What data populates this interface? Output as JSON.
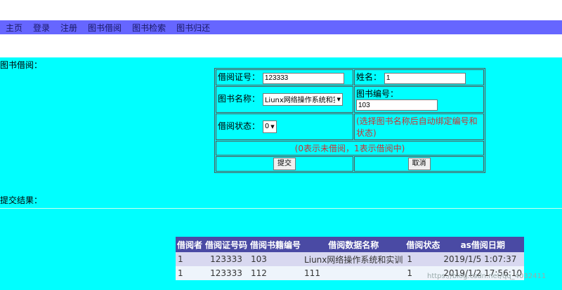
{
  "nav": {
    "items": [
      "主页",
      "登录",
      "注册",
      "图书借阅",
      "图书检索",
      "图书归还"
    ]
  },
  "borrow_section": {
    "title": "图书借阅："
  },
  "form": {
    "card_label": "借阅证号：",
    "card_value": "123333",
    "name_label": "姓名：",
    "name_value": "1",
    "book_name_label": "图书名称：",
    "book_name_selected": "Liunx网络操作系统和实",
    "book_id_label": "图书编号：",
    "book_id_value": "103",
    "status_label": "借阅状态：",
    "status_selected": "0",
    "auto_hint": "(选择图书名称后自动绑定编号和状态)",
    "status_hint": "(0表示未借阅，1表示借阅中)",
    "submit_label": "提交",
    "cancel_label": "取消"
  },
  "result_section": {
    "title": "提交结果："
  },
  "result_table": {
    "headers": [
      "借阅者",
      "借阅证号码",
      "借阅书籍编号",
      "借阅数据名称",
      "借阅状态",
      "as借阅日期"
    ],
    "rows": [
      [
        "1",
        "123333",
        "103",
        "Liunx网络操作系统和实训",
        "1",
        "2019/1/5 1:07:37"
      ],
      [
        "1",
        "123333",
        "112",
        "111",
        "1",
        "2019/1/2 17:56:10"
      ]
    ]
  },
  "watermark": "https://blog.csdn.net/qq_4032411"
}
